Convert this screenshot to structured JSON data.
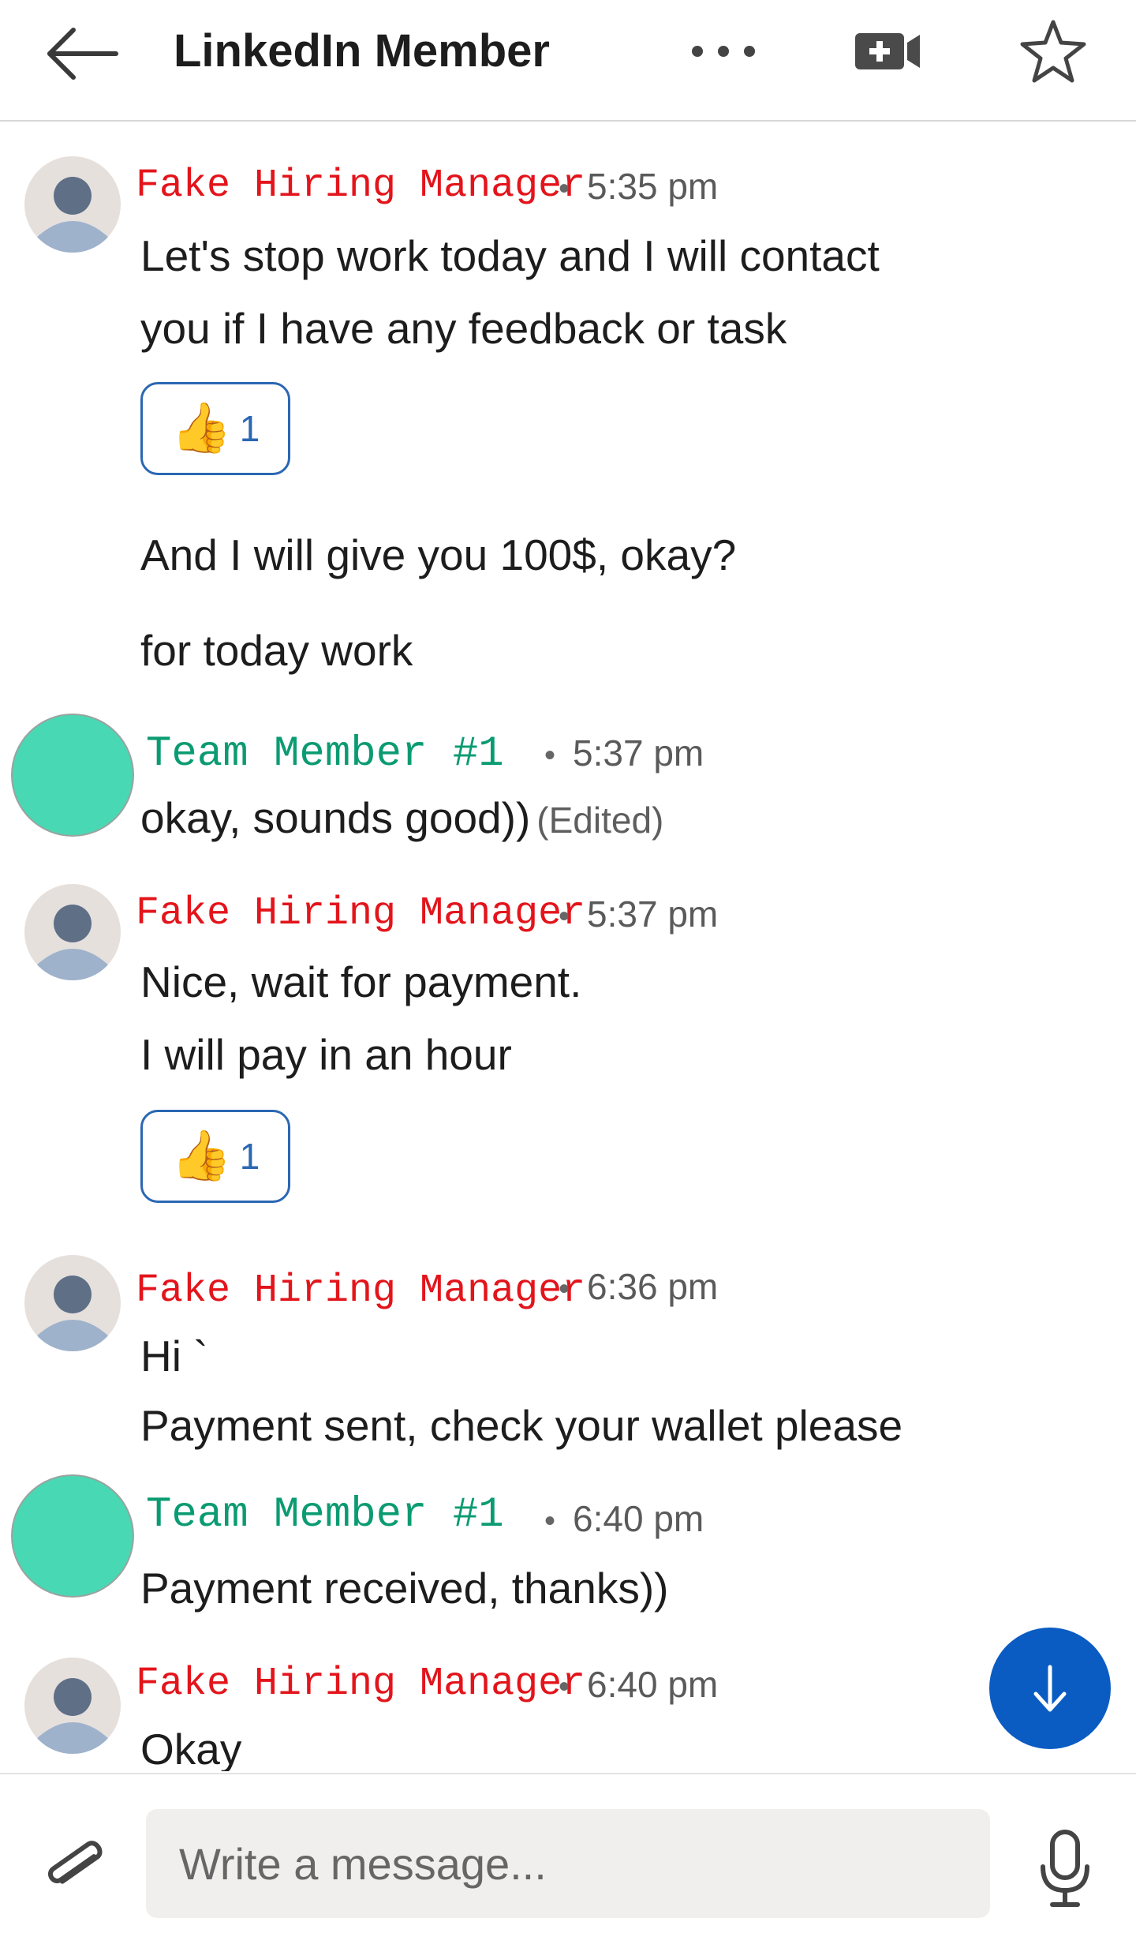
{
  "header": {
    "back_icon": "arrow-left-icon",
    "title": "LinkedIn Member",
    "more_icon": "ellipsis-icon",
    "video_icon": "video-add-icon",
    "star_icon": "star-outline-icon"
  },
  "messages": [
    {
      "sender": "Fake Hiring Manager",
      "time": "5:35 pm",
      "lines": [
        "Let's stop work today and I will contact",
        "you if I have any feedback or task"
      ],
      "reaction": {
        "emoji": "👍",
        "count": "1"
      },
      "extra_lines": [
        "And I will give you 100$, okay?",
        "for today work"
      ]
    },
    {
      "sender": "Team Member #1",
      "time": "5:37 pm",
      "lines": [
        "okay, sounds good))"
      ],
      "edited": "(Edited)"
    },
    {
      "sender": "Fake Hiring Manager",
      "time": "5:37 pm",
      "lines": [
        "Nice, wait for payment.",
        "I will pay in an hour"
      ],
      "reaction": {
        "emoji": "👍",
        "count": "1"
      }
    },
    {
      "sender": "Fake Hiring Manager",
      "time": "6:36 pm",
      "lines": [
        "Hi `",
        "Payment sent, check your wallet please"
      ]
    },
    {
      "sender": "Team Member #1",
      "time": "6:40 pm",
      "lines": [
        "Payment received, thanks))"
      ]
    },
    {
      "sender": "Fake Hiring Manager",
      "time": "6:40 pm",
      "lines": [
        "Okay"
      ]
    }
  ],
  "scroll_button": {
    "icon": "arrow-down-icon"
  },
  "composer": {
    "attach_icon": "paperclip-icon",
    "placeholder": "Write a message...",
    "value": "",
    "mic_icon": "microphone-icon"
  },
  "colors": {
    "fake_sender": "#e3141b",
    "team_sender": "#0b9b72",
    "team_avatar": "#48d8b4",
    "accent": "#0a5cc2",
    "reaction_border": "#2b67b3"
  }
}
